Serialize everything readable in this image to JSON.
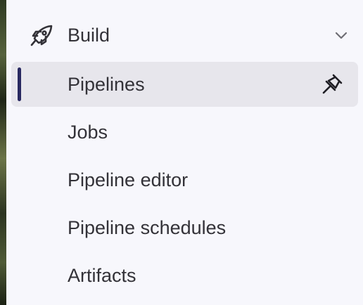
{
  "section": {
    "label": "Build",
    "icon": "rocket-icon",
    "expanded": true
  },
  "items": [
    {
      "label": "Pipelines",
      "active": true,
      "pinned_icon": "pin-icon"
    },
    {
      "label": "Jobs",
      "active": false
    },
    {
      "label": "Pipeline editor",
      "active": false
    },
    {
      "label": "Pipeline schedules",
      "active": false
    },
    {
      "label": "Artifacts",
      "active": false
    }
  ],
  "colors": {
    "background": "#f7f7fc",
    "active_background": "#e7e6ec",
    "active_indicator": "#292961",
    "text": "#333238"
  }
}
